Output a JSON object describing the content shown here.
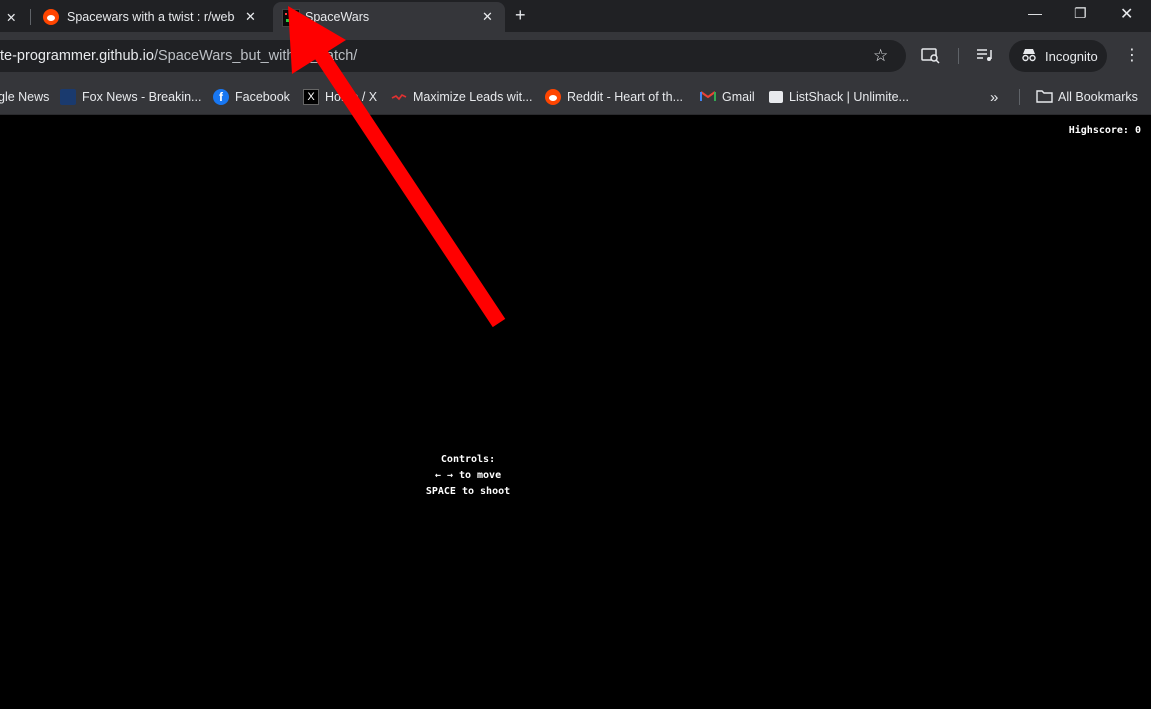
{
  "tabs": [
    {
      "title": "Spacewars with a twist : r/webdev",
      "active": false,
      "icon": "reddit-icon"
    },
    {
      "title": "SpaceWars",
      "active": true,
      "icon": "spacewars-favicon"
    }
  ],
  "window_controls": {
    "minimize": "—",
    "restore": "❐",
    "close": "✕"
  },
  "address_bar": {
    "host": "te-programmer.github.io",
    "path": "/SpaceWars_but_with_a_catch/"
  },
  "toolbar": {
    "incognito_label": "Incognito"
  },
  "bookmarks": [
    {
      "label": "gle News",
      "icon": "google-news-icon"
    },
    {
      "label": "Fox News - Breakin...",
      "icon": "fox-news-icon"
    },
    {
      "label": "Facebook",
      "icon": "facebook-icon"
    },
    {
      "label": "Home / X",
      "icon": "x-icon"
    },
    {
      "label": "Maximize Leads wit...",
      "icon": "leads-icon"
    },
    {
      "label": "Reddit - Heart of th...",
      "icon": "reddit-icon"
    },
    {
      "label": "Gmail",
      "icon": "gmail-icon"
    },
    {
      "label": "ListShack | Unlimite...",
      "icon": "listshack-icon"
    }
  ],
  "all_bookmarks_label": "All Bookmarks",
  "game": {
    "highscore": "Highscore: 0",
    "controls_title": "Controls:",
    "controls_move": "← → to move",
    "controls_shoot": "SPACE to shoot"
  },
  "colors": {
    "annotation_arrow": "#ff0000",
    "tab_active": "#35363a",
    "tabstrip": "#202124"
  }
}
